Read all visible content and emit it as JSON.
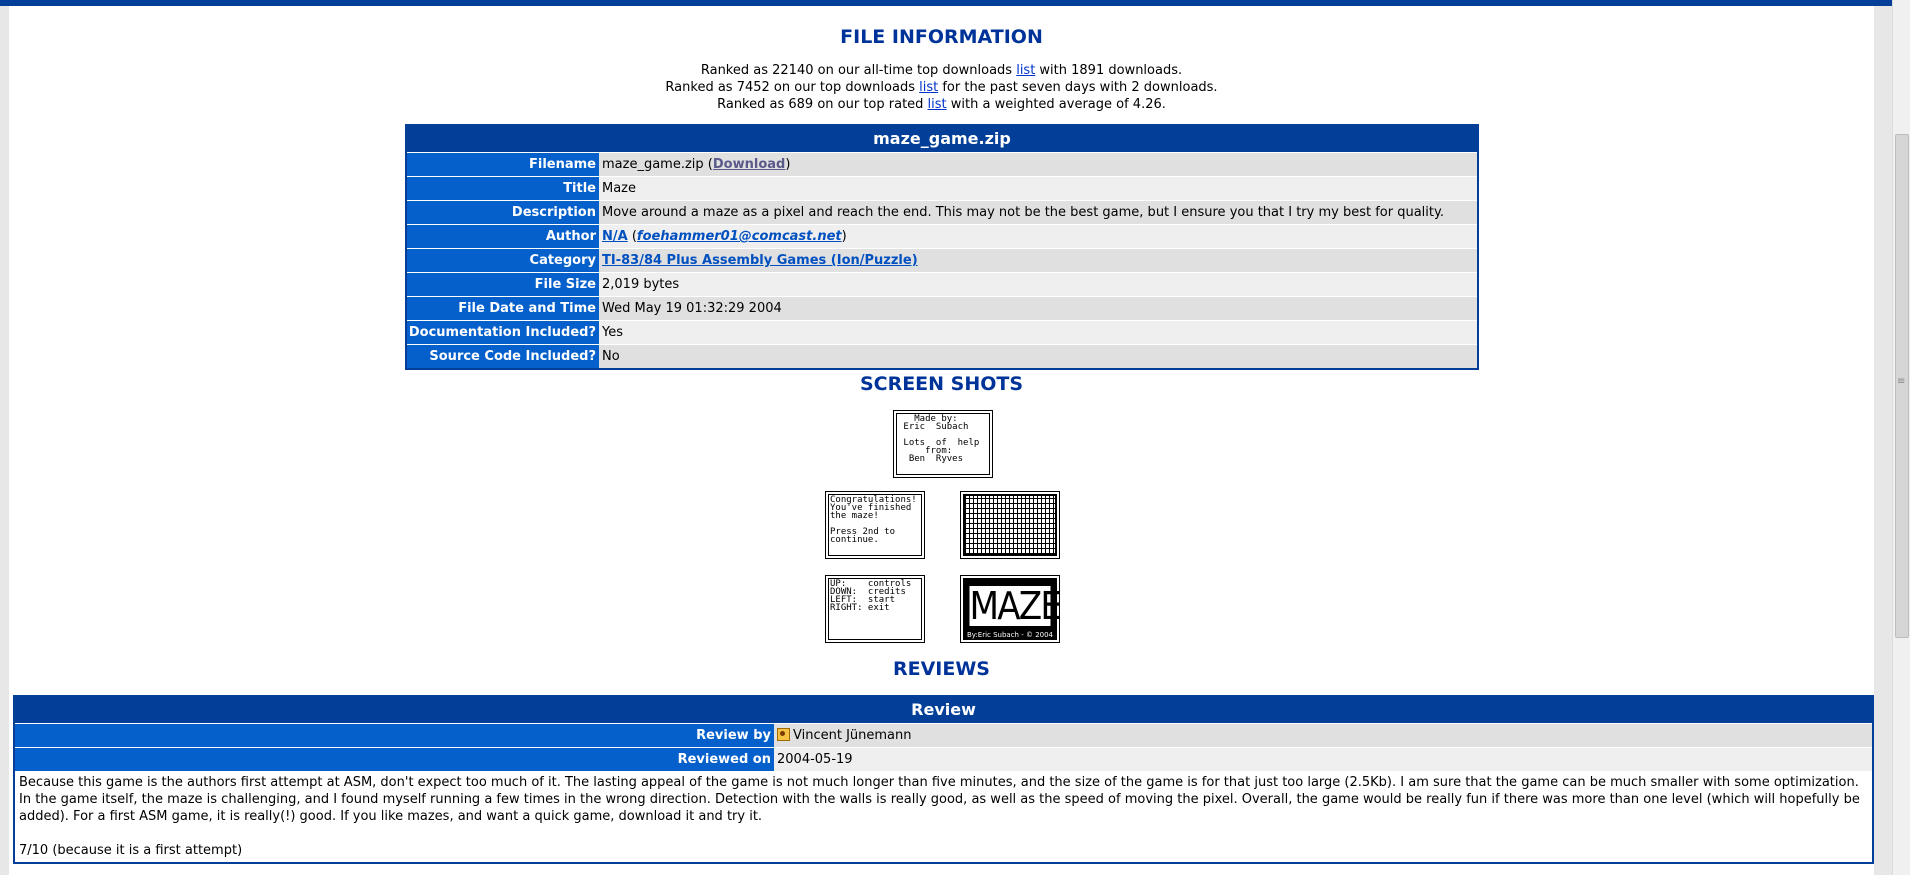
{
  "file_info": {
    "heading": "FILE INFORMATION",
    "rank_lines": [
      {
        "before": "Ranked as 22140 on our all-time top downloads ",
        "link": "list",
        "after": " with 1891 downloads."
      },
      {
        "before": "Ranked as 7452 on our top downloads ",
        "link": "list",
        "after": " for the past seven days with 2 downloads."
      },
      {
        "before": "Ranked as 689 on our top rated ",
        "link": "list",
        "after": " with a weighted average of 4.26."
      }
    ],
    "table_caption": "maze_game.zip",
    "labels": {
      "filename": "Filename",
      "title": "Title",
      "description": "Description",
      "author": "Author",
      "category": "Category",
      "file_size": "File Size",
      "file_date": "File Date and Time",
      "docs": "Documentation Included?",
      "source": "Source Code Included?"
    },
    "filename": "maze_game.zip",
    "download_text": "Download",
    "title": "Maze",
    "description": "Move around a maze as a pixel and reach the end. This may not be the best game, but I ensure you that I try my best for quality.",
    "author_name": "N/A",
    "author_email": "foehammer01@comcast.net",
    "category": "TI-83/84 Plus Assembly Games (Ion/Puzzle)",
    "file_size": "2,019 bytes",
    "file_date": "Wed May 19 01:32:29 2004",
    "docs": "Yes",
    "source": "No"
  },
  "screenshots": {
    "heading": "SCREEN SHOTS",
    "credits_text": "   Made by:\n Eric  Subach\n\n Lots  of  help\n     from:\n  Ben  Ryves",
    "congrats_text": "Congratulations!\nYou've finished\nthe maze!\n\nPress 2nd to\ncontinue.",
    "menu_text": "UP:    controls\nDOWN:  credits\nLEFT:  start\nRIGHT: exit",
    "logo_word": "MAZE",
    "logo_sub": "By:Eric Subach - © 2004"
  },
  "reviews": {
    "heading": "REVIEWS",
    "caption": "Review",
    "review_by_label": "Review by",
    "reviewer": "Vincent Jünemann",
    "reviewed_on_label": "Reviewed on",
    "reviewed_on": "2004-05-19",
    "body": "Because this game is the authors first attempt at ASM, don't expect too much of it. The lasting appeal of the game is not much longer than five minutes, and the size of the game is for that just too large (2.5Kb). I am sure that the game can be much smaller with some optimization. In the game itself, the maze is challenging, and I found myself running a few times in the wrong direction. Detection with the walls is really good, as well as the speed of moving the pixel. Overall, the game would be really fun if there was more than one level (which will hopefully be added). For a first ASM game, it is really(!) good. If you like mazes, and want a quick game, download it and try it.",
    "score": "7/10 (because it is a first attempt)"
  }
}
